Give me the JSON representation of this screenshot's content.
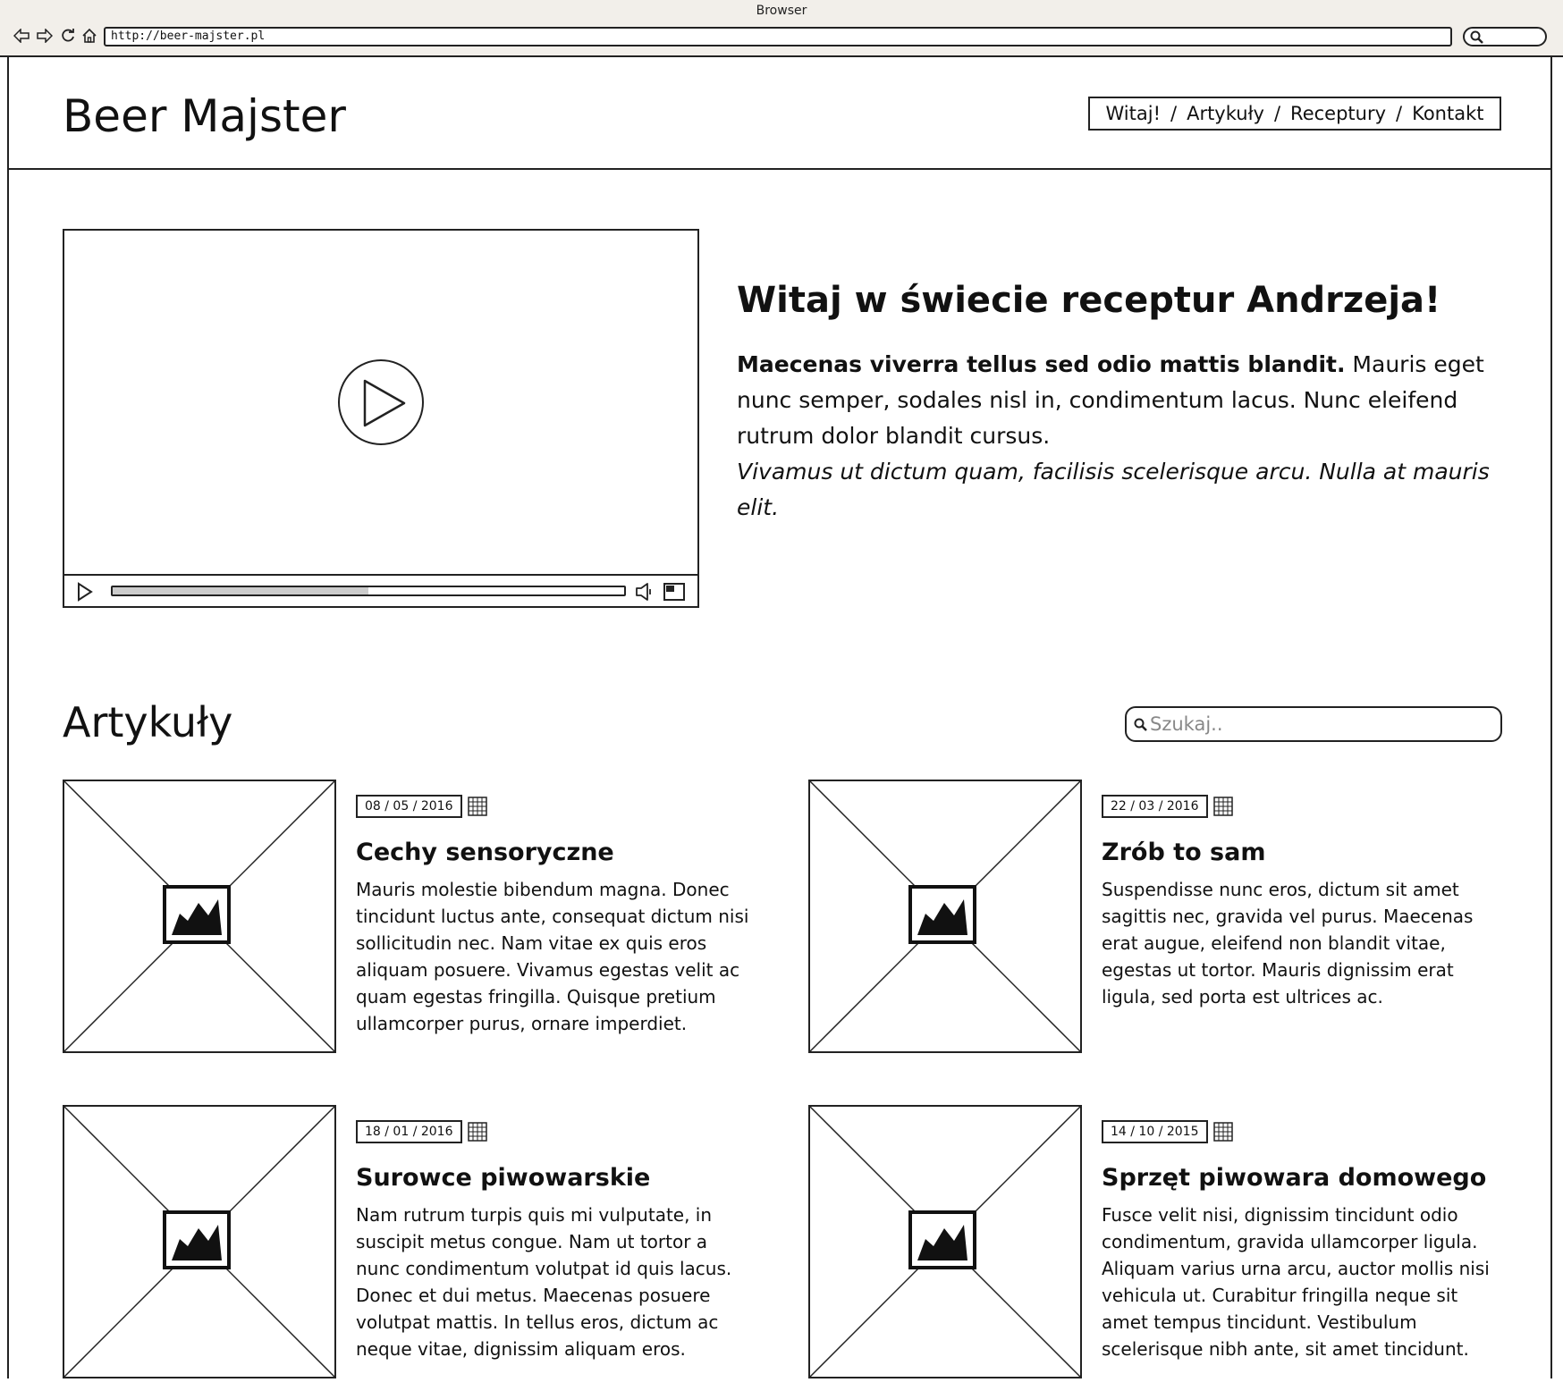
{
  "browser": {
    "title": "Browser",
    "url": "http://beer-majster.pl"
  },
  "site": {
    "logo": "Beer Majster",
    "nav": [
      {
        "label": "Witaj!"
      },
      {
        "label": "Artykuły"
      },
      {
        "label": "Receptury"
      },
      {
        "label": "Kontakt"
      }
    ],
    "nav_separator": "/"
  },
  "video": {
    "progress_fraction": 0.5
  },
  "hero": {
    "title": "Witaj w świecie receptur Andrzeja!",
    "lead": "Maecenas viverra tellus sed odio mattis blandit.",
    "body": " Mauris eget nunc semper, sodales nisl in, condimentum lacus. Nunc eleifend rutrum dolor blandit cursus.",
    "italic": "Vivamus ut dictum quam, facilisis scelerisque arcu. Nulla at mauris elit."
  },
  "articles": {
    "title": "Artykuły",
    "search_placeholder": "Szukaj..",
    "search_value": "",
    "items": [
      {
        "date": "08 / 05 / 2016",
        "title": "Cechy sensoryczne",
        "text": "Mauris molestie bibendum magna. Donec tincidunt luctus ante, consequat dictum nisi sollicitudin nec. Nam vitae ex quis eros aliquam posuere. Vivamus egestas velit ac quam egestas fringilla. Quisque pretium ullamcorper purus, ornare imperdiet."
      },
      {
        "date": "22 / 03 / 2016",
        "title": "Zrób to sam",
        "text": "Suspendisse nunc eros, dictum sit amet sagittis nec, gravida vel purus. Maecenas erat augue, eleifend non blandit vitae, egestas ut tortor. Mauris dignissim erat ligula, sed porta est ultrices ac."
      },
      {
        "date": "18 / 01 / 2016",
        "title": "Surowce piwowarskie",
        "text": "Nam rutrum turpis quis mi vulputate, in suscipit metus congue. Nam ut tortor a nunc condimentum volutpat id quis lacus. Donec et dui metus. Maecenas posuere volutpat mattis. In tellus eros, dictum ac neque vitae, dignissim aliquam eros."
      },
      {
        "date": "14 / 10 / 2015",
        "title": "Sprzęt piwowara domowego",
        "text": "Fusce velit nisi, dignissim tincidunt odio condimentum, gravida ullamcorper ligula. Aliquam varius urna arcu, auctor mollis nisi vehicula ut. Curabitur fringilla neque sit amet tempus tincidunt. Vestibulum scelerisque nibh ante, sit amet tincidunt."
      }
    ]
  },
  "icons": {
    "back": "back-arrow-icon",
    "forward": "forward-arrow-icon",
    "reload": "reload-icon",
    "home": "home-icon",
    "search": "search-icon",
    "play": "play-icon",
    "volume": "volume-icon",
    "fullscreen": "fullscreen-icon",
    "calendar": "calendar-icon",
    "image": "image-placeholder-icon"
  },
  "colors": {
    "ink": "#111111",
    "chrome": "#f2efea",
    "progress_fill": "#cccccc",
    "placeholder": "#888888"
  }
}
